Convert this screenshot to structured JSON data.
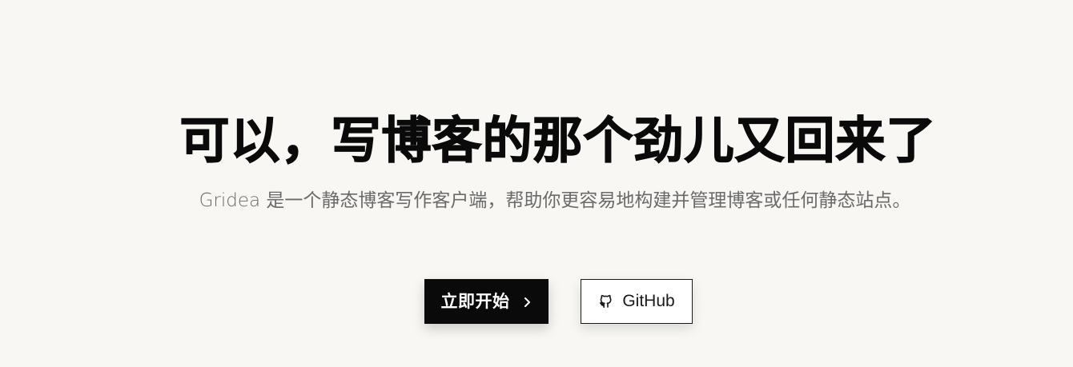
{
  "hero": {
    "title": "可以，写博客的那个劲儿又回来了",
    "subtitle": "Gridea 是一个静态博客写作客户端，帮助你更容易地构建并管理博客或任何静态站点。"
  },
  "actions": {
    "primary": {
      "label": "立即开始",
      "icon": "chevron-right-icon"
    },
    "secondary": {
      "label": "GitHub",
      "icon": "github-icon"
    }
  },
  "colors": {
    "background": "#f8f7f3",
    "primary_button": "#0a0a0a",
    "text": "#0a0a0a",
    "subtitle": "#6a6a6a"
  }
}
